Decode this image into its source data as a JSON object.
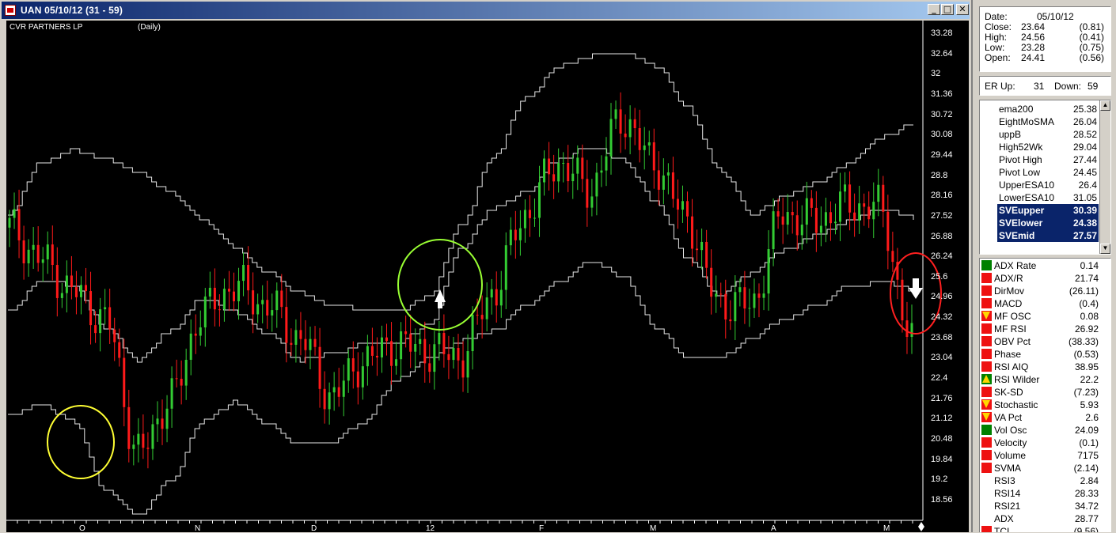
{
  "window": {
    "title": "UAN 05/10/12 (31 - 59)",
    "buttons": {
      "minimize": "_",
      "maximize": "□",
      "close": "✕"
    }
  },
  "chart": {
    "symbol_name": "CVR PARTNERS  LP",
    "period": "(Daily)",
    "y_ticks": [
      "33.28",
      "32.64",
      "32",
      "31.36",
      "30.72",
      "30.08",
      "29.44",
      "28.8",
      "28.16",
      "27.52",
      "26.88",
      "26.24",
      "25.6",
      "24.96",
      "24.32",
      "23.68",
      "23.04",
      "22.4",
      "21.76",
      "21.12",
      "20.48",
      "19.84",
      "19.2",
      "18.56"
    ],
    "x_ticks": [
      "O",
      "N",
      "D",
      "12",
      "F",
      "M",
      "A",
      "M"
    ],
    "colors": {
      "up": "#33cc33",
      "down": "#ff1a1a",
      "band": "#e8e8e8",
      "yellow_circle": "#ffff33",
      "green_circle": "#99ff33",
      "red_circle": "#ff2020"
    }
  },
  "chart_data": {
    "type": "candlestick",
    "title": "CVR PARTNERS  LP",
    "ylim": [
      18.2,
      33.6
    ],
    "y_ticks": [
      33.28,
      32.64,
      32,
      31.36,
      30.72,
      30.08,
      29.44,
      28.8,
      28.16,
      27.52,
      26.88,
      26.24,
      25.6,
      24.96,
      24.32,
      23.68,
      23.04,
      22.4,
      21.76,
      21.12,
      20.48,
      19.84,
      19.2,
      18.56
    ],
    "x_ticks": [
      "O",
      "N",
      "D",
      "12",
      "F",
      "M",
      "A",
      "M"
    ],
    "series": [
      {
        "name": "SVEupper",
        "values": [
          27.6,
          29.2,
          29.6,
          29.3,
          28.9,
          28.3,
          27.4,
          26.6,
          25.8,
          25.2,
          24.8,
          24.7,
          24.6,
          25.1,
          27.3,
          29.4,
          31.2,
          32.2,
          32.5,
          32.6,
          32.2,
          30.9,
          29.0,
          27.6,
          28.2,
          28.6,
          29.2,
          30.0,
          30.4
        ]
      },
      {
        "name": "SVEmid",
        "values": [
          24.6,
          25.6,
          25.4,
          24.1,
          23.1,
          24.0,
          25.0,
          24.6,
          23.9,
          23.1,
          23.3,
          23.6,
          23.6,
          24.2,
          26.6,
          27.8,
          28.3,
          29.3,
          29.7,
          29.3,
          28.0,
          26.2,
          25.1,
          25.8,
          26.5,
          27.0,
          27.4,
          27.8,
          27.5
        ]
      },
      {
        "name": "SVElower",
        "values": [
          21.4,
          21.7,
          21.2,
          19.1,
          18.3,
          19.4,
          21.2,
          21.8,
          21.1,
          20.5,
          20.6,
          21.2,
          22.5,
          23.2,
          23.7,
          24.0,
          24.8,
          25.5,
          26.2,
          25.7,
          24.1,
          23.2,
          23.2,
          23.8,
          24.4,
          24.8,
          25.4,
          25.5,
          25.3
        ]
      },
      {
        "name": "close",
        "values": [
          27.2,
          26.2,
          25.2,
          24.3,
          20.2,
          21.9,
          24.6,
          25.4,
          24.8,
          23.8,
          22.0,
          23.1,
          23.6,
          23.4,
          23.2,
          25.2,
          27.6,
          29.2,
          28.4,
          30.6,
          29.2,
          27.5,
          24.9,
          24.8,
          27.6,
          27.4,
          27.9,
          27.8,
          23.64
        ]
      }
    ],
    "annotations": [
      "yellow circle",
      "green circle with up arrow",
      "red circle with down arrow"
    ]
  },
  "info": {
    "date_label": "Date:",
    "date_value": "05/10/12",
    "rows": [
      {
        "label": "Close:",
        "value": "23.64",
        "change": "(0.81)"
      },
      {
        "label": "High:",
        "value": "24.56",
        "change": "(0.41)"
      },
      {
        "label": "Low:",
        "value": "23.28",
        "change": "(0.75)"
      },
      {
        "label": "Open:",
        "value": "24.41",
        "change": "(0.56)"
      }
    ]
  },
  "er": {
    "up_label": "ER Up:",
    "up": "31",
    "down_label": "Down:",
    "down": "59"
  },
  "study_list": [
    {
      "name": "ema200",
      "value": "25.38",
      "selected": false
    },
    {
      "name": "EightMoSMA",
      "value": "26.04",
      "selected": false
    },
    {
      "name": "uppB",
      "value": "28.52",
      "selected": false
    },
    {
      "name": "High52Wk",
      "value": "29.04",
      "selected": false
    },
    {
      "name": "Pivot High",
      "value": "27.44",
      "selected": false
    },
    {
      "name": "Pivot Low",
      "value": "24.45",
      "selected": false
    },
    {
      "name": "UpperESA10",
      "value": "26.4",
      "selected": false
    },
    {
      "name": "LowerESA10",
      "value": "31.05",
      "selected": false
    },
    {
      "name": "SVEupper",
      "value": "30.39",
      "selected": true
    },
    {
      "name": "SVElower",
      "value": "24.38",
      "selected": true
    },
    {
      "name": "SVEmid",
      "value": "27.57",
      "selected": true
    }
  ],
  "indicators": [
    {
      "name": "ADX Rate",
      "value": "0.14",
      "marker": "green"
    },
    {
      "name": "ADX/R",
      "value": "21.74",
      "marker": "red"
    },
    {
      "name": "DirMov",
      "value": "(26.11)",
      "marker": "red"
    },
    {
      "name": "MACD",
      "value": "(0.4)",
      "marker": "red"
    },
    {
      "name": "MF OSC",
      "value": "0.08",
      "marker": "down"
    },
    {
      "name": "MF RSI",
      "value": "26.92",
      "marker": "red"
    },
    {
      "name": "OBV Pct",
      "value": "(38.33)",
      "marker": "red"
    },
    {
      "name": "Phase",
      "value": "(0.53)",
      "marker": "red"
    },
    {
      "name": "RSI AIQ",
      "value": "38.95",
      "marker": "red"
    },
    {
      "name": "RSI Wilder",
      "value": "22.2",
      "marker": "upg"
    },
    {
      "name": "SK-SD",
      "value": "(7.23)",
      "marker": "red"
    },
    {
      "name": "Stochastic",
      "value": "5.93",
      "marker": "down"
    },
    {
      "name": "VA Pct",
      "value": "2.6",
      "marker": "down"
    },
    {
      "name": "Vol Osc",
      "value": "24.09",
      "marker": "green"
    },
    {
      "name": "Velocity",
      "value": "(0.1)",
      "marker": "red"
    },
    {
      "name": "Volume",
      "value": "7175",
      "marker": "red"
    },
    {
      "name": "SVMA",
      "value": "(2.14)",
      "marker": "red"
    },
    {
      "name": "RSI3",
      "value": "2.84",
      "marker": "none"
    },
    {
      "name": "RSI14",
      "value": "28.33",
      "marker": "none"
    },
    {
      "name": "RSI21",
      "value": "34.72",
      "marker": "none"
    },
    {
      "name": "ADX",
      "value": "28.77",
      "marker": "none"
    },
    {
      "name": "TCI",
      "value": "(9.56)",
      "marker": "red"
    }
  ]
}
